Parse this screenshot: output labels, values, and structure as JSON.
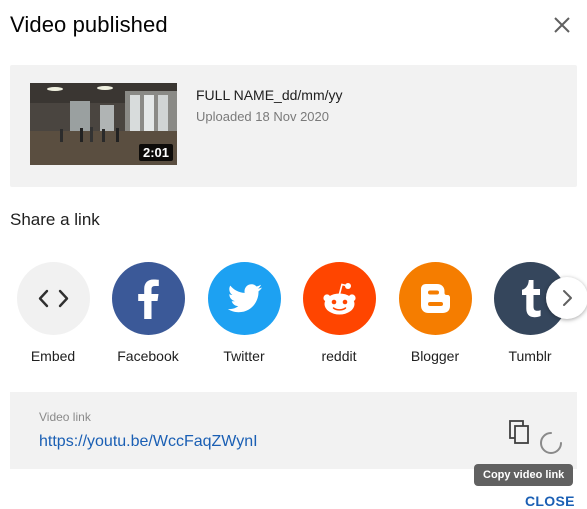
{
  "dialog": {
    "title": "Video published",
    "close_icon": "close-icon"
  },
  "video": {
    "name": "FULL NAME_dd/mm/yy",
    "uploaded": "Uploaded 18 Nov 2020",
    "duration": "2:01"
  },
  "share": {
    "label": "Share a link",
    "items": [
      {
        "label": "Embed",
        "icon": "embed-icon",
        "color": "#f1f1f1"
      },
      {
        "label": "Facebook",
        "icon": "facebook-icon",
        "color": "#3b5998"
      },
      {
        "label": "Twitter",
        "icon": "twitter-icon",
        "color": "#1da1f2"
      },
      {
        "label": "reddit",
        "icon": "reddit-icon",
        "color": "#ff4500"
      },
      {
        "label": "Blogger",
        "icon": "blogger-icon",
        "color": "#f57d00"
      },
      {
        "label": "Tumblr",
        "icon": "tumblr-icon",
        "color": "#35465c"
      }
    ],
    "next_icon": "chevron-right-icon"
  },
  "link": {
    "label": "Video link",
    "url": "https://youtu.be/WccFaqZWynI",
    "copy_icon": "copy-icon",
    "tooltip": "Copy video link"
  },
  "footer": {
    "close_label": "CLOSE"
  },
  "colors": {
    "accent": "#1a5fb4",
    "card_bg": "#f2f2f2"
  }
}
